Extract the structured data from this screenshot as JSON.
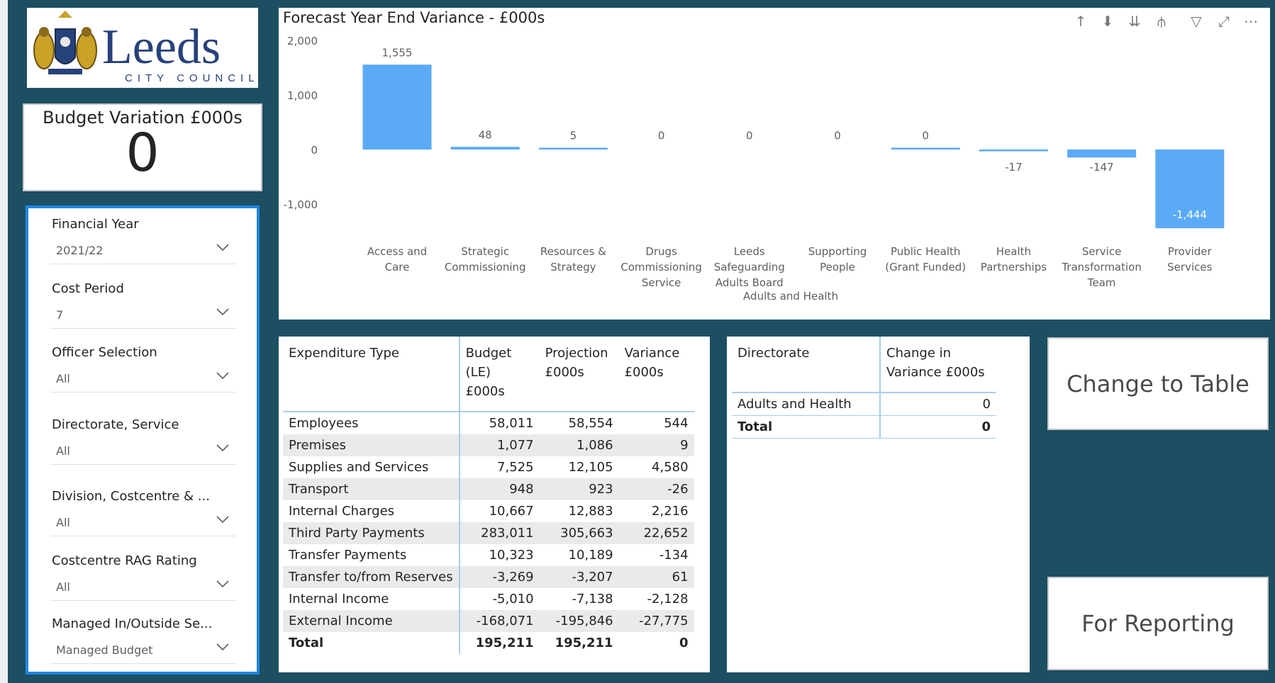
{
  "logo": {
    "word": "Leeds",
    "sub": "CITY COUNCIL"
  },
  "card": {
    "title": "Budget Variation £000s",
    "value": "0"
  },
  "slicers": [
    {
      "label": "Financial Year",
      "value": "2021/22"
    },
    {
      "label": "Cost Period",
      "value": "7"
    },
    {
      "label": "Officer Selection",
      "value": "All"
    },
    {
      "label": "Directorate, Service",
      "value": "All"
    },
    {
      "label": "Division, Costcentre & ...",
      "value": "All"
    },
    {
      "label": "Costcentre RAG Rating",
      "value": "All"
    },
    {
      "label": "Managed In/Outside Se...",
      "value": "Managed Budget"
    }
  ],
  "chart_title": "Forecast Year End Variance - £000s",
  "chart_data": {
    "type": "bar",
    "title": "Forecast Year End Variance - £000s",
    "categories": [
      [
        "Access and",
        "Care"
      ],
      [
        "Strategic",
        "Commissioning"
      ],
      [
        "Resources &",
        "Strategy"
      ],
      [
        "Drugs",
        "Commissioning",
        "Service"
      ],
      [
        "Leeds",
        "Safeguarding",
        "Adults Board"
      ],
      [
        "Supporting",
        "People"
      ],
      [
        "Public Health",
        "(Grant Funded)"
      ],
      [
        "Health",
        "Partnerships"
      ],
      [
        "Service",
        "Transformation",
        "Team"
      ],
      [
        "Provider",
        "Services"
      ]
    ],
    "values": [
      1555,
      48,
      5,
      0,
      0,
      0,
      0,
      -17,
      -147,
      -1444
    ],
    "labels": [
      "1,555",
      "48",
      "5",
      "0",
      "0",
      "0",
      "0",
      "-17",
      "-147",
      "-1,444"
    ],
    "group_label": "Adults and Health",
    "yticks": [
      2000,
      1000,
      0,
      -1000
    ],
    "ytick_labels": [
      "2,000",
      "1,000",
      "0",
      "-1,000"
    ],
    "ylim": [
      -1500,
      2000
    ],
    "color": "#5aaaf5"
  },
  "expenditure": {
    "headers": [
      "Expenditure Type",
      "Budget\n(LE) £000s",
      "Projection\n£000s",
      "Variance\n£000s"
    ],
    "rows": [
      [
        "Employees",
        "58,011",
        "58,554",
        "544"
      ],
      [
        "Premises",
        "1,077",
        "1,086",
        "9"
      ],
      [
        "Supplies and Services",
        "7,525",
        "12,105",
        "4,580"
      ],
      [
        "Transport",
        "948",
        "923",
        "-26"
      ],
      [
        "Internal Charges",
        "10,667",
        "12,883",
        "2,216"
      ],
      [
        "Third Party Payments",
        "283,011",
        "305,663",
        "22,652"
      ],
      [
        "Transfer Payments",
        "10,323",
        "10,189",
        "-134"
      ],
      [
        "Transfer to/from Reserves",
        "-3,269",
        "-3,207",
        "61"
      ],
      [
        "Internal Income",
        "-5,010",
        "-7,138",
        "-2,128"
      ],
      [
        "External Income",
        "-168,071",
        "-195,846",
        "-27,775"
      ]
    ],
    "total": [
      "Total",
      "195,211",
      "195,211",
      "0"
    ]
  },
  "directorate": {
    "headers": [
      "Directorate",
      "Change in\nVariance £000s"
    ],
    "rows": [
      [
        "Adults and Health",
        "0"
      ]
    ],
    "total": [
      "Total",
      "0"
    ]
  },
  "buttons": {
    "change_to_table": "Change to Table",
    "for_reporting": "For Reporting"
  }
}
